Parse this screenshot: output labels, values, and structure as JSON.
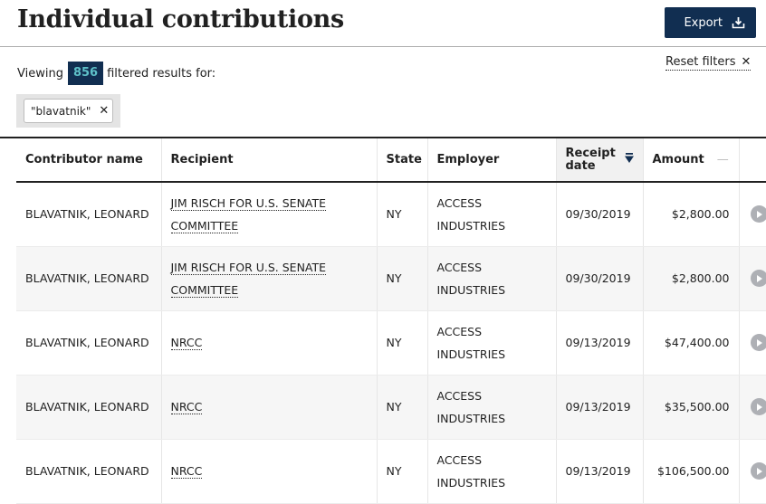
{
  "header": {
    "title": "Individual contributions",
    "export_label": "Export",
    "export_icon": "download-icon"
  },
  "filters": {
    "viewing_prefix": "Viewing",
    "count": "856",
    "viewing_suffix": "filtered results for:",
    "reset_label": "Reset filters",
    "reset_icon": "close-icon",
    "tags": [
      {
        "label": "\"blavatnik\"",
        "remove_icon": "close-icon"
      }
    ]
  },
  "table": {
    "columns": [
      {
        "label": "Contributor name"
      },
      {
        "label": "Recipient"
      },
      {
        "label": "State"
      },
      {
        "label": "Employer"
      },
      {
        "label": "Receipt date",
        "sorted": "descending"
      },
      {
        "label": "Amount",
        "indicator": "—"
      }
    ],
    "rows": [
      {
        "contributor": "BLAVATNIK, LEONARD",
        "recipient_line1": "JIM RISCH FOR U.S. SENATE",
        "recipient_line2": "COMMITTEE",
        "state": "NY",
        "employer_line1": "ACCESS",
        "employer_line2": "INDUSTRIES",
        "date": "09/30/2019",
        "amount": "$2,800.00"
      },
      {
        "contributor": "BLAVATNIK, LEONARD",
        "recipient_line1": "JIM RISCH FOR U.S. SENATE",
        "recipient_line2": "COMMITTEE",
        "state": "NY",
        "employer_line1": "ACCESS",
        "employer_line2": "INDUSTRIES",
        "date": "09/30/2019",
        "amount": "$2,800.00"
      },
      {
        "contributor": "BLAVATNIK, LEONARD",
        "recipient_line1": "NRCC",
        "recipient_line2": "",
        "state": "NY",
        "employer_line1": "ACCESS",
        "employer_line2": "INDUSTRIES",
        "date": "09/13/2019",
        "amount": "$47,400.00"
      },
      {
        "contributor": "BLAVATNIK, LEONARD",
        "recipient_line1": "NRCC",
        "recipient_line2": "",
        "state": "NY",
        "employer_line1": "ACCESS",
        "employer_line2": "INDUSTRIES",
        "date": "09/13/2019",
        "amount": "$35,500.00"
      },
      {
        "contributor": "BLAVATNIK, LEONARD",
        "recipient_line1": "NRCC",
        "recipient_line2": "",
        "state": "NY",
        "employer_line1": "ACCESS",
        "employer_line2": "INDUSTRIES",
        "date": "09/13/2019",
        "amount": "$106,500.00"
      }
    ]
  },
  "colors": {
    "primary_navy": "#112e51",
    "count_text": "#5ec0c8",
    "play_icon": "#aeb0b5"
  }
}
